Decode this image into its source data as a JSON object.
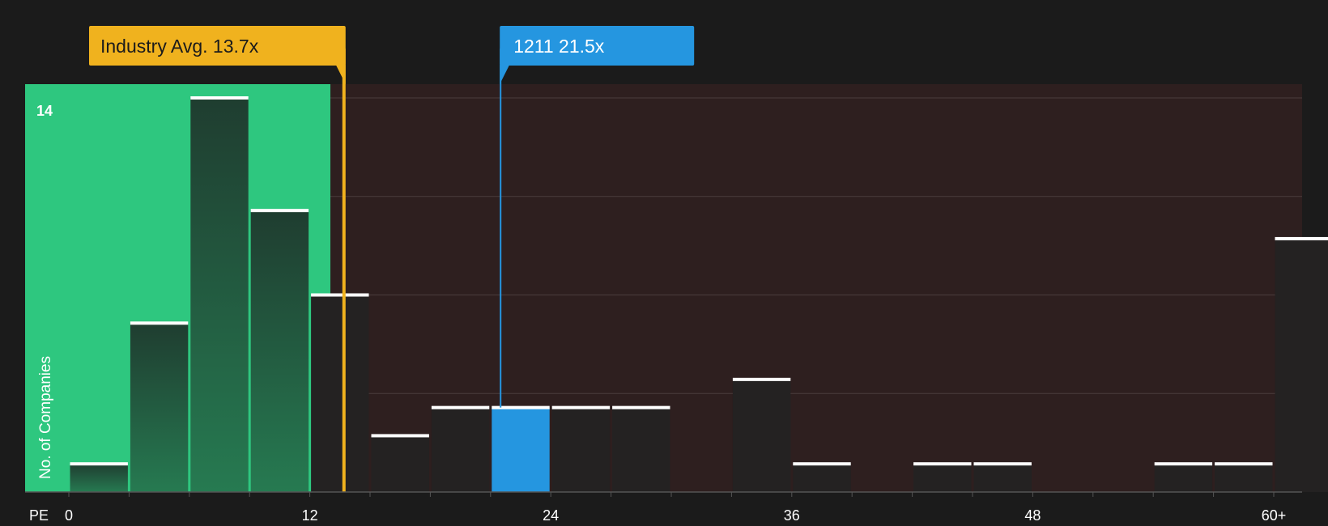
{
  "chart_data": {
    "type": "bar",
    "x_axis_label": "PE",
    "y_axis_label": "No. of Companies",
    "y_tick_label": "14",
    "y_tick_value": 14,
    "x_ticks": [
      "0",
      "12",
      "24",
      "36",
      "48",
      "60+"
    ],
    "x_tick_values": [
      0,
      12,
      24,
      36,
      48,
      60
    ],
    "xlim": [
      0,
      61.5
    ],
    "ylim": [
      0,
      14.5
    ],
    "bin_width": 3,
    "bin_starts": [
      0,
      3,
      6,
      9,
      12,
      15,
      18,
      21,
      24,
      27,
      30,
      33,
      36,
      39,
      42,
      45,
      48,
      51,
      54,
      57,
      60
    ],
    "values": [
      1,
      6,
      14,
      10,
      7,
      2,
      3,
      3,
      3,
      3,
      0,
      4,
      1,
      0,
      1,
      1,
      0,
      0,
      1,
      1,
      9
    ],
    "highlight_bin_start": 21,
    "industry_avg": {
      "label": "Industry Avg. 13.7x",
      "value": 13.7
    },
    "company": {
      "label": "1211 21.5x",
      "value": 21.5
    },
    "colors": {
      "background": "#1b1b1b",
      "undervalued_zone": "#2ec77f",
      "overvalued_zone": "#2e1f1f",
      "bar_default": "#242222",
      "bar_in_green_zone": "#1f4a34",
      "bar_highlight": "#2596e0",
      "bar_cap": "#ffffff",
      "industry_avg": "#f0b21e",
      "company": "#2596e0",
      "gridline": "#4a3d3d",
      "axis": "#555555",
      "text": "#ffffff"
    }
  }
}
